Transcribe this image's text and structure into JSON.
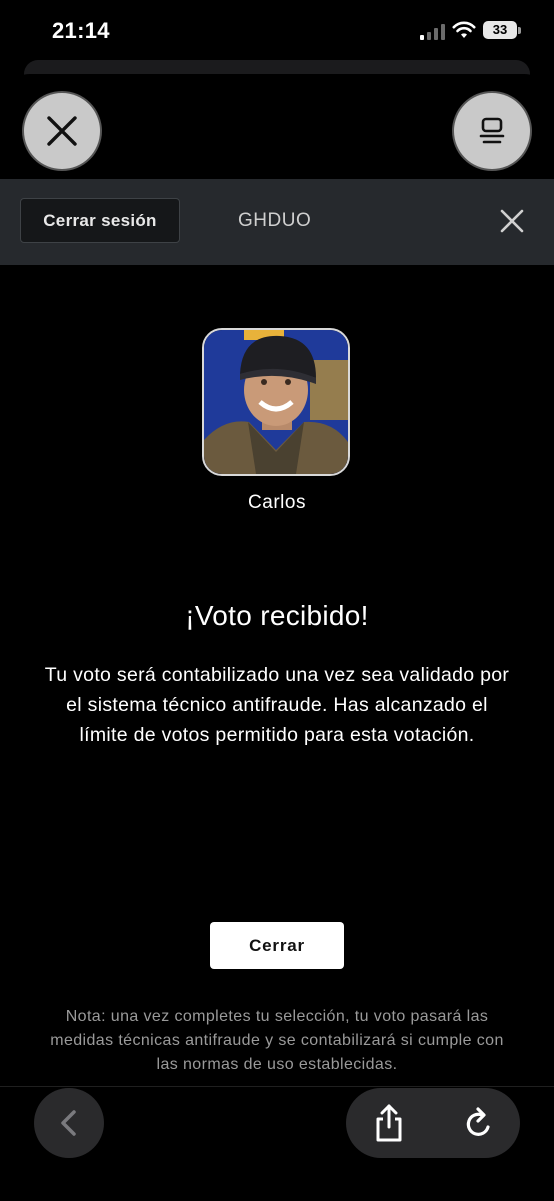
{
  "status_bar": {
    "time": "21:14",
    "battery": "33"
  },
  "header": {
    "logout_label": "Cerrar sesión",
    "title": "GHDUO"
  },
  "candidate": {
    "name": "Carlos"
  },
  "confirmation": {
    "headline": "¡Voto recibido!",
    "message": "Tu voto será contabilizado una vez sea validado por el sistema técnico antifraude. Has alcanzado el límite de votos permitido para esta votación.",
    "button_label": "Cerrar"
  },
  "note": "Nota: una vez completes tu selección, tu voto pasará las medidas técnicas antifraude y se contabilizará si cumple con las normas de uso establecidas.",
  "icons": {
    "top_left": "close-icon",
    "top_right": "tabs-icon",
    "header_close": "close-icon",
    "back": "chevron-left-icon",
    "share": "share-icon",
    "reload": "reload-icon"
  },
  "colors": {
    "header_bg": "#26292d",
    "button_bg": "#ffffff",
    "avatar_bg": "#1f3a9a"
  }
}
